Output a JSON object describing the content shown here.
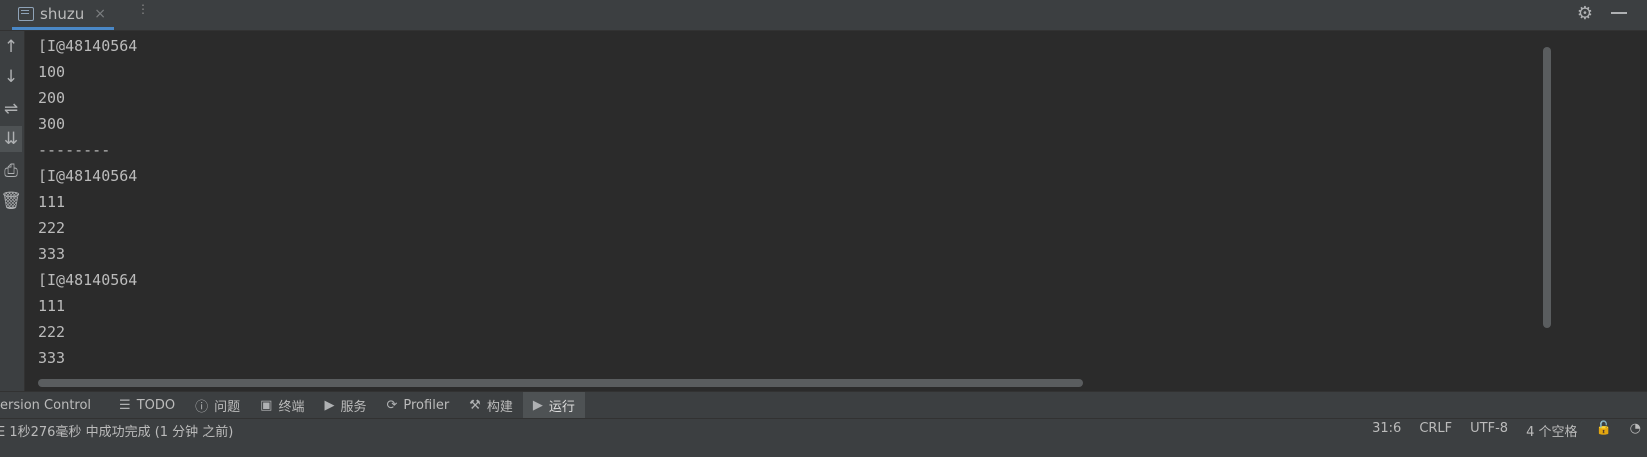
{
  "tab": {
    "title": "shuzu",
    "close_glyph": "×",
    "more_glyph": "⋮"
  },
  "header_icons": [
    "gear-icon",
    "minimize-icon"
  ],
  "gutter_icons": [
    "arrow-up-icon",
    "arrow-down-icon",
    "soft-wrap-icon",
    "scroll-to-end-icon",
    "print-icon",
    "trash-icon"
  ],
  "console": {
    "lines": [
      "[I@48140564",
      "100",
      "200",
      "300",
      "--------",
      "[I@48140564",
      "111",
      "222",
      "333",
      "[I@48140564",
      "111",
      "222",
      "333"
    ]
  },
  "toolwindows": [
    {
      "label": "ersion Control",
      "icon": ""
    },
    {
      "label": "TODO",
      "icon": "☰"
    },
    {
      "label": "问题",
      "icon": "ⓘ"
    },
    {
      "label": "终端",
      "icon": "▣"
    },
    {
      "label": "服务",
      "icon": "▶"
    },
    {
      "label": "Profiler",
      "icon": "⟳"
    },
    {
      "label": "构建",
      "icon": "⚒"
    },
    {
      "label": "运行",
      "icon": "▶"
    }
  ],
  "status": {
    "message": "E 1秒276毫秒 中成功完成 (1 分钟 之前)",
    "position": "31:6",
    "line_separator": "CRLF",
    "encoding": "UTF-8",
    "indent": "4 个空格"
  }
}
